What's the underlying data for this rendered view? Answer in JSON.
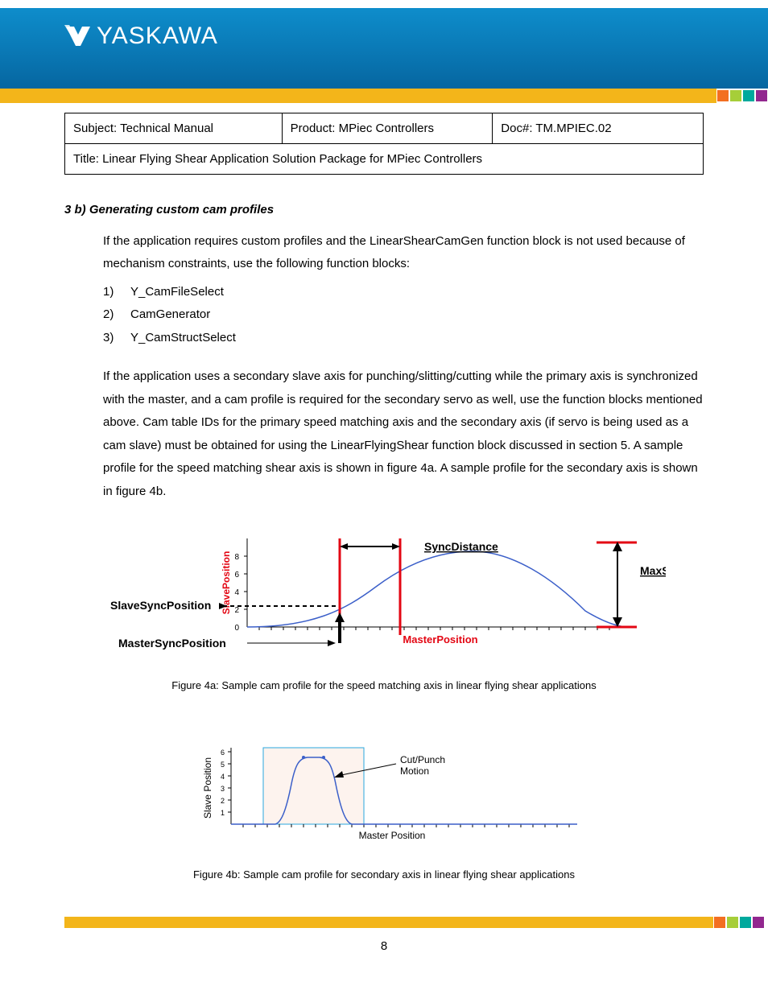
{
  "brand": "YASKAWA",
  "header": {
    "subject_label": "Subject:",
    "subject_value": "Technical Manual",
    "product_label": "Product:",
    "product_value": "MPiec Controllers",
    "doc_label": "Doc#:",
    "doc_value": "TM.MPIEC.02",
    "title_label": "Title:",
    "title_value": "Linear Flying Shear Application Solution Package for MPiec Controllers"
  },
  "section": {
    "heading": "3 b) Generating custom cam profiles",
    "intro": "If the application requires custom profiles and the LinearShearCamGen function block is not used because of mechanism constraints, use the following function blocks:",
    "list": [
      {
        "num": "1)",
        "text": "Y_CamFileSelect"
      },
      {
        "num": "2)",
        "text": "CamGenerator"
      },
      {
        "num": "3)",
        "text": "Y_CamStructSelect"
      }
    ],
    "para2": "If the application uses a secondary slave axis for punching/slitting/cutting while the primary axis is synchronized with the master, and a cam profile is required for the secondary servo as well, use the function blocks mentioned above.   Cam table IDs for the primary speed matching axis and the secondary axis (if servo is being used as a cam slave) must be obtained for using the LinearFlyingShear function block discussed in section 5.   A sample profile for the speed matching shear axis is shown in figure 4a.   A sample profile for the secondary axis is shown in figure 4b."
  },
  "figure4a": {
    "caption": "Figure 4a: Sample cam profile for the speed matching axis in linear flying shear applications",
    "labels": {
      "slave_position": "SlavePosition",
      "slave_sync_position": "SlaveSyncPosition",
      "master_sync_position": "MasterSyncPosition",
      "sync_distance": "SyncDistance",
      "master_position": "MasterPosition",
      "max_stroke": "MaxStroke"
    },
    "y_ticks": [
      "0",
      "2",
      "4",
      "6",
      "8"
    ]
  },
  "figure4b": {
    "caption": "Figure 4b: Sample cam profile for secondary axis in linear flying shear applications",
    "labels": {
      "slave_position": "Slave Position",
      "master_position": "Master Position",
      "cut_punch": "Cut/Punch",
      "motion": "Motion"
    },
    "y_ticks": [
      "1",
      "2",
      "3",
      "4",
      "5",
      "6"
    ]
  },
  "page_number": "8",
  "chart_data": [
    {
      "type": "line",
      "name": "figure-4a",
      "title": "Sample cam profile for the speed matching axis in linear flying shear applications",
      "xlabel": "MasterPosition",
      "ylabel": "SlavePosition",
      "ylim": [
        0,
        8
      ],
      "annotations": [
        "SlaveSyncPosition",
        "MasterSyncPosition",
        "SyncDistance",
        "MaxStroke"
      ],
      "series": [
        {
          "name": "cam-profile",
          "x": [
            0,
            2,
            4,
            6,
            8,
            10,
            12,
            14,
            16,
            18,
            20,
            22,
            24,
            26,
            28,
            30
          ],
          "values": [
            0,
            0.1,
            0.4,
            1.0,
            2.0,
            3.4,
            5.0,
            6.4,
            7.4,
            7.9,
            7.8,
            6.8,
            5.0,
            2.6,
            0.8,
            0.1
          ]
        }
      ]
    },
    {
      "type": "line",
      "name": "figure-4b",
      "title": "Sample cam profile for secondary axis in linear flying shear applications",
      "xlabel": "Master Position",
      "ylabel": "Slave Position",
      "ylim": [
        0,
        6
      ],
      "annotations": [
        "Cut/Punch Motion"
      ],
      "series": [
        {
          "name": "cut-punch-profile",
          "x": [
            0,
            2,
            4,
            5,
            6,
            7,
            8,
            9,
            10,
            11,
            12,
            13,
            14,
            16,
            30
          ],
          "values": [
            0,
            0,
            0,
            0.3,
            1.5,
            4.0,
            5.5,
            5.6,
            5.6,
            5.5,
            4.0,
            1.5,
            0.3,
            0,
            0
          ]
        }
      ]
    }
  ]
}
